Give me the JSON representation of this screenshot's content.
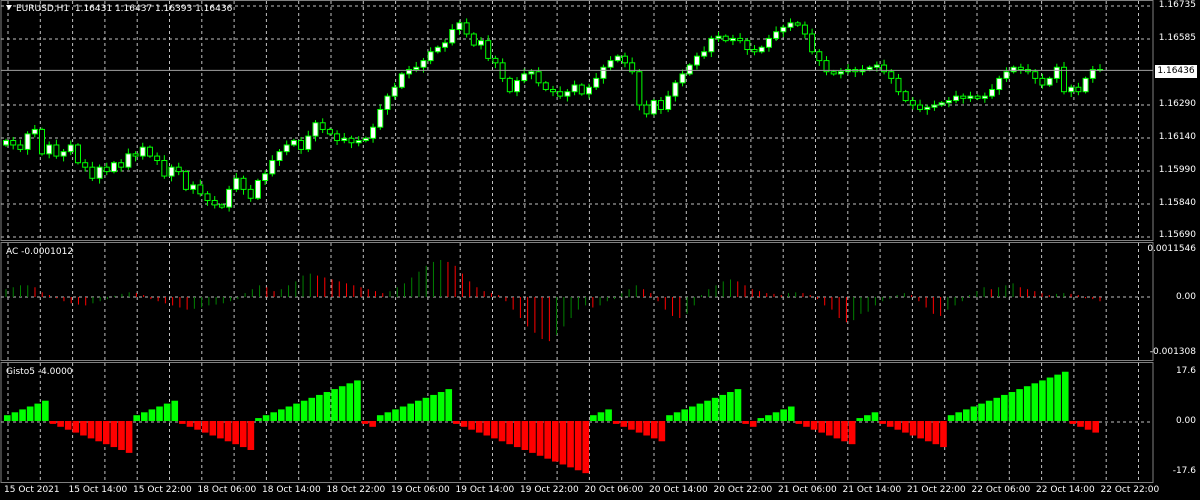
{
  "header": {
    "symbol_timeframe": "EURUSD,H1",
    "ohlc": "1.16431 1.16437 1.16393 1.16436"
  },
  "price_scale": {
    "labels": [
      "1.16735",
      "1.16585",
      "1.16436",
      "1.16290",
      "1.16140",
      "1.15990",
      "1.15840",
      "1.15690"
    ],
    "current_price": "1.16436"
  },
  "ac_panel": {
    "title": "AC -0.0001012",
    "labels": [
      "0.0011546",
      "0.00",
      "-0.001308"
    ]
  },
  "gisto_panel": {
    "title": "Gisto5 -4.0000",
    "labels": [
      "17.6",
      "0.00",
      "-17.6"
    ]
  },
  "time_axis": {
    "labels": [
      "15 Oct 2021",
      "15 Oct 14:00",
      "15 Oct 22:00",
      "18 Oct 06:00",
      "18 Oct 14:00",
      "18 Oct 22:00",
      "19 Oct 06:00",
      "19 Oct 14:00",
      "19 Oct 22:00",
      "20 Oct 06:00",
      "20 Oct 14:00",
      "20 Oct 22:00",
      "21 Oct 06:00",
      "21 Oct 14:00",
      "21 Oct 22:00",
      "22 Oct 06:00",
      "22 Oct 14:00",
      "22 Oct 22:00"
    ]
  },
  "colors": {
    "background": "#000000",
    "grid": "#c0c0c0",
    "bull_candle": "#ffffff",
    "candle_outline": "#00ff00",
    "ac_up": "#008000",
    "ac_down": "#ff0000",
    "gisto_up": "#00ff00",
    "gisto_down": "#ff0000",
    "current_line": "#a0a0a0"
  },
  "chart_data": [
    {
      "type": "candlestick",
      "name": "price",
      "ylim": [
        1.1569,
        1.16735
      ],
      "closes": [
        1.1612,
        1.161,
        1.1608,
        1.1615,
        1.1617,
        1.1606,
        1.161,
        1.1605,
        1.1607,
        1.161,
        1.1602,
        1.16,
        1.1595,
        1.16,
        1.1598,
        1.1602,
        1.16,
        1.1606,
        1.1605,
        1.1609,
        1.1605,
        1.1603,
        1.1596,
        1.16,
        1.1598,
        1.159,
        1.1592,
        1.1588,
        1.1585,
        1.1583,
        1.1582,
        1.159,
        1.1595,
        1.159,
        1.1586,
        1.1594,
        1.1597,
        1.1603,
        1.1607,
        1.161,
        1.1612,
        1.1608,
        1.1614,
        1.162,
        1.1617,
        1.1615,
        1.1612,
        1.1613,
        1.1611,
        1.1612,
        1.1613,
        1.1618,
        1.1626,
        1.1632,
        1.1636,
        1.1642,
        1.1644,
        1.1645,
        1.1648,
        1.1652,
        1.1654,
        1.1656,
        1.1662,
        1.1665,
        1.166,
        1.1655,
        1.1657,
        1.1649,
        1.1647,
        1.164,
        1.1634,
        1.1639,
        1.1642,
        1.1643,
        1.1638,
        1.1635,
        1.1634,
        1.1632,
        1.1634,
        1.1637,
        1.1633,
        1.1636,
        1.164,
        1.1645,
        1.1648,
        1.165,
        1.1647,
        1.1643,
        1.1628,
        1.1624,
        1.163,
        1.1626,
        1.1632,
        1.1638,
        1.1642,
        1.1646,
        1.165,
        1.1652,
        1.1658,
        1.1659,
        1.1657,
        1.1658,
        1.1657,
        1.1653,
        1.1652,
        1.1654,
        1.1658,
        1.1661,
        1.1663,
        1.1665,
        1.1664,
        1.166,
        1.1652,
        1.1648,
        1.1643,
        1.1642,
        1.1643,
        1.1644,
        1.1643,
        1.1644,
        1.1645,
        1.1646,
        1.1643,
        1.164,
        1.1634,
        1.163,
        1.1628,
        1.1626,
        1.1627,
        1.1628,
        1.1629,
        1.163,
        1.1632,
        1.1631,
        1.1632,
        1.1631,
        1.1632,
        1.1635,
        1.164,
        1.1643,
        1.1645,
        1.1644,
        1.1643,
        1.164,
        1.1637,
        1.164,
        1.1645,
        1.1634,
        1.1636,
        1.1634,
        1.164,
        1.1644,
        1.1644
      ]
    },
    {
      "type": "bar",
      "name": "AC",
      "ylim": [
        -0.001308,
        0.0011546
      ],
      "values": [
        0.0002,
        0.00025,
        0.0003,
        0.0003,
        0.00025,
        0.00012,
        5e-05,
        -3e-05,
        -0.0001,
        -0.00015,
        -0.00018,
        -0.0002,
        -0.00015,
        -0.0001,
        -5e-05,
        3e-05,
        8e-05,
        0.00012,
        0.0001,
        5e-05,
        -5e-05,
        -0.0001,
        -0.00015,
        -0.0002,
        -0.00025,
        -0.0003,
        -0.00028,
        -0.00025,
        -0.0002,
        -0.00018,
        -0.00015,
        -0.0001,
        -5e-05,
        0.0001,
        0.0002,
        0.0003,
        0.00025,
        0.00015,
        0.0002,
        0.0003,
        0.0004,
        0.00055,
        0.0006,
        0.00055,
        0.0005,
        0.00045,
        0.0004,
        0.00035,
        0.0003,
        0.00025,
        0.0002,
        0.00015,
        0.0001,
        0.00015,
        0.00025,
        0.00035,
        0.0005,
        0.00065,
        0.0008,
        0.0009,
        0.00095,
        0.0009,
        0.0008,
        0.0006,
        0.0004,
        0.00025,
        0.00015,
        0.0001,
        5e-05,
        -0.0001,
        -0.0003,
        -0.0005,
        -0.0007,
        -0.00085,
        -0.001,
        -0.00105,
        -0.0009,
        -0.0007,
        -0.0005,
        -0.0003,
        -0.0002,
        -0.00025,
        -0.0002,
        -0.0001,
        -5e-05,
        0.0001,
        0.0002,
        0.0003,
        0.0002,
        0.0001,
        -0.0001,
        -0.0003,
        -0.00045,
        -0.0005,
        -0.0004,
        -0.0002,
        5e-05,
        0.0002,
        0.0003,
        0.0004,
        0.00045,
        0.0004,
        0.0003,
        0.0002,
        0.00015,
        0.0001,
        8e-05,
        5e-05,
        0.0001,
        0.00012,
        0.0001,
        5e-05,
        -5e-05,
        -0.0002,
        -0.0003,
        -0.0005,
        -0.0006,
        -0.00055,
        -0.0004,
        -0.00035,
        -0.0002,
        -0.0001,
        -5e-05,
        5e-05,
        0.0001,
        5e-05,
        -0.0001,
        -0.00025,
        -0.0004,
        -0.00045,
        -0.0003,
        -0.0002,
        -0.0001,
        5e-05,
        0.00015,
        0.00025,
        0.0002,
        0.00025,
        0.0003,
        0.00035,
        0.00025,
        0.0002,
        0.00015,
        0.0001,
        5e-05,
        8e-05,
        0.0001,
        8e-05,
        5e-05,
        -3e-05,
        -5e-05,
        -0.0001
      ]
    },
    {
      "type": "bar",
      "name": "Gisto5",
      "ylim": [
        -17.6,
        17.6
      ],
      "values": [
        2,
        3,
        4,
        5,
        6,
        7,
        -1,
        -2,
        -3,
        -4,
        -5,
        -6,
        -7,
        -8,
        -9,
        -10,
        -11,
        2,
        3,
        4,
        5,
        6,
        7,
        -1,
        -2,
        -3,
        -4,
        -5,
        -6,
        -7,
        -8,
        -9,
        -10,
        1,
        2,
        3,
        4,
        5,
        6,
        7,
        8,
        9,
        10,
        11,
        12,
        13,
        14,
        -1,
        -2,
        2,
        3,
        4,
        5,
        6,
        7,
        8,
        9,
        10,
        11,
        -1,
        -2,
        -3,
        -4,
        -5,
        -6,
        -7,
        -8,
        -9,
        -10,
        -11,
        -12,
        -13,
        -14,
        -15,
        -16,
        -17,
        -18,
        2,
        3,
        4,
        -1,
        -2,
        -3,
        -4,
        -5,
        -6,
        -7,
        2,
        3,
        4,
        5,
        6,
        7,
        8,
        9,
        10,
        11,
        -1,
        -2,
        1,
        2,
        3,
        4,
        5,
        -1,
        -2,
        -3,
        -4,
        -5,
        -6,
        -7,
        -8,
        1,
        2,
        3,
        -1,
        -2,
        -3,
        -4,
        -5,
        -6,
        -7,
        -8,
        -9,
        2,
        3,
        4,
        5,
        6,
        7,
        8,
        9,
        10,
        11,
        12,
        13,
        14,
        15,
        16,
        17,
        -1,
        -2,
        -3,
        -4
      ]
    }
  ]
}
